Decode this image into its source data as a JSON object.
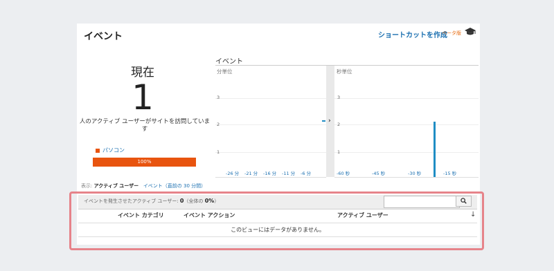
{
  "header": {
    "title": "イベント",
    "shortcut_label": "ショートカットを作成",
    "beta_label": "ベータ版",
    "cap_icon": "graduation-cap-icon"
  },
  "realtime": {
    "now_label": "現在",
    "active_count": "1",
    "description": "人のアクティブ ユーザーがサイトを訪問しています",
    "device_label": "パソコン",
    "device_percent_text": "100%",
    "device_fraction": 1.0,
    "device_color": "#e8540f"
  },
  "chart_data": [
    {
      "type": "bar",
      "title": "イベント",
      "panel_label": "分単位",
      "x_ticks": [
        "-26 分",
        "-21 分",
        "-16 分",
        "-11 分",
        "-6 分"
      ],
      "y_ticks": [
        "3",
        "2",
        "1"
      ],
      "ylim": [
        0,
        3
      ],
      "values_note_series": [
        {
          "values": [
            0,
            0,
            0,
            0,
            0
          ]
        }
      ]
    },
    {
      "type": "bar",
      "panel_label": "秒単位",
      "x_ticks": [
        "-60 秒",
        "-45 秒",
        "-30 秒",
        "-15 秒"
      ],
      "y_ticks": [
        "3",
        "2",
        "1"
      ],
      "ylim": [
        0,
        3
      ],
      "bars": [
        {
          "x": "-26 秒",
          "value": 2
        }
      ]
    }
  ],
  "view": {
    "prefix": "表示:",
    "active_tab": "アクティブ ユーザー",
    "other_tab": "イベント（直前の 30 分間）"
  },
  "table": {
    "info_prefix": "イベントを発生させたアクティブ ユーザー:",
    "info_count": "0",
    "info_suffix": "（全体の",
    "info_pct": "0%",
    "info_close": "）",
    "columns": [
      "イベント カテゴリ",
      "イベント アクション",
      "アクティブ ユーザー"
    ],
    "sort_icon": "sort-down-arrow-icon",
    "search_placeholder": "",
    "empty_message": "このビューにはデータがありません。"
  },
  "colors": {
    "accent": "#1a6fb0",
    "bar": "#1f8dc4",
    "highlight": "#e6838a"
  }
}
